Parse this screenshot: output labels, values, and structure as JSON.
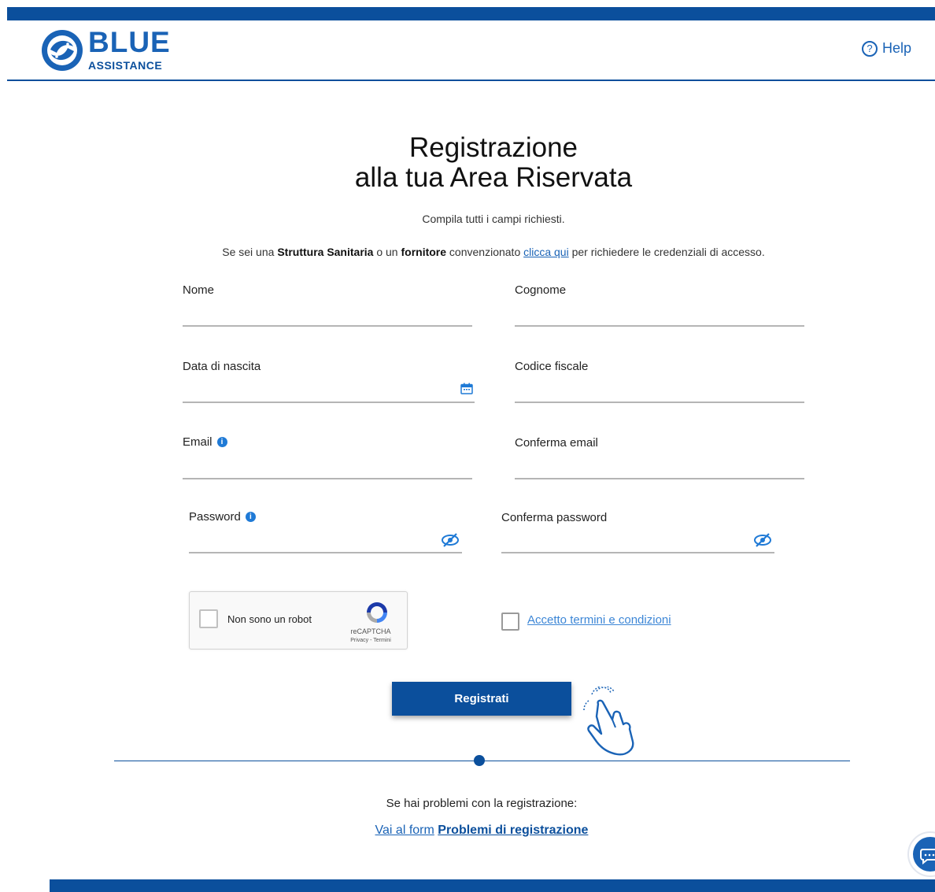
{
  "header": {
    "logo_main": "BLUE",
    "logo_sub": "ASSISTANCE",
    "help_label": "Help",
    "brand_color": "#0b4f9c"
  },
  "intro": {
    "title_line1": "Registrazione",
    "title_line2": "alla tua Area Riservata",
    "subtitle": "Compila tutti i campi richiesti.",
    "notice_part1": "Se sei una ",
    "notice_bold1": "Struttura Sanitaria",
    "notice_part2": " o un ",
    "notice_bold2": "fornitore",
    "notice_part3": " convenzionato ",
    "notice_link": "clicca qui",
    "notice_part4": " per richiedere le credenziali di accesso."
  },
  "form": {
    "nome_label": "Nome",
    "nome_value": "",
    "cognome_label": "Cognome",
    "cognome_value": "",
    "data_nascita_label": "Data di nascita",
    "data_nascita_value": "",
    "codice_fiscale_label": "Codice fiscale",
    "codice_fiscale_value": "",
    "email_label": "Email",
    "email_value": "",
    "conferma_email_label": "Conferma email",
    "conferma_email_value": "",
    "password_label": "Password",
    "password_value": "",
    "conferma_password_label": "Conferma password",
    "conferma_password_value": "",
    "info_glyph": "i"
  },
  "recaptcha": {
    "label": "Non sono un robot",
    "brand": "reCAPTCHA",
    "links": "Privacy - Termini"
  },
  "terms": {
    "label": "Accetto termini e condizioni",
    "checked": false
  },
  "actions": {
    "register_label": "Registrati"
  },
  "problems": {
    "text": "Se hai problemi con la registrazione:",
    "link_prefix": "Vai al form",
    "link_bold": "Problemi di registrazione"
  },
  "icons": {
    "help": "help-circle-icon",
    "calendar": "calendar-icon",
    "info": "info-icon",
    "eye_hidden": "eye-slash-icon",
    "recaptcha": "recaptcha-logo-icon",
    "hand": "pointing-hand-icon",
    "chat": "chat-icon"
  }
}
